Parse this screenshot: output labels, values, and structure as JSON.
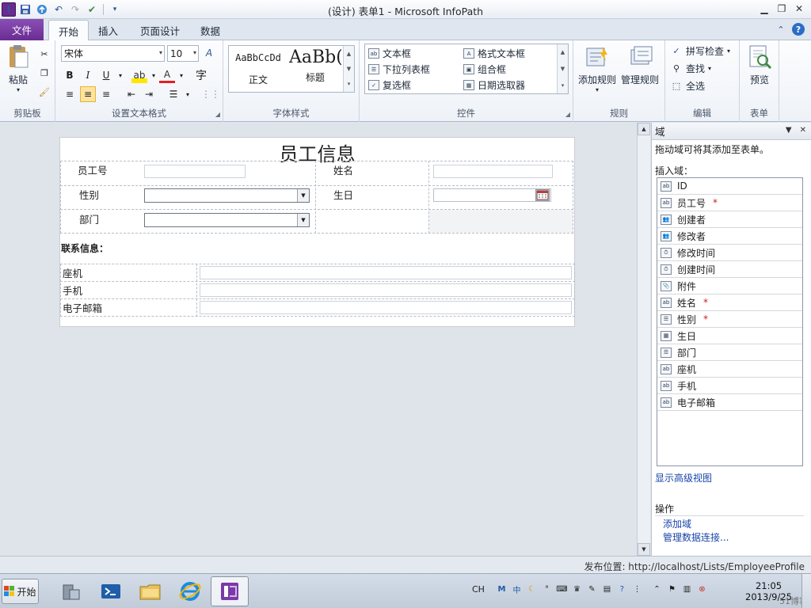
{
  "window": {
    "title": "(设计) 表单1 - Microsoft InfoPath",
    "app_icon_letter": "I"
  },
  "tabs": [
    {
      "label": "文件"
    },
    {
      "label": "开始"
    },
    {
      "label": "插入"
    },
    {
      "label": "页面设计"
    },
    {
      "label": "数据"
    }
  ],
  "ribbon": {
    "clipboard": {
      "paste_label": "粘贴",
      "group_label": "剪贴板"
    },
    "font": {
      "font_name": "宋体",
      "font_size": "10",
      "group_label": "设置文本格式",
      "char_btn": "字"
    },
    "styles": {
      "normal_preview": "AaBbCcDd",
      "normal_label": "正文",
      "heading_preview": "AaBb(",
      "heading_label": "标题",
      "group_label": "字体样式"
    },
    "controls": {
      "items": [
        "文本框",
        "下拉列表框",
        "复选框",
        "格式文本框",
        "组合框",
        "日期选取器"
      ],
      "group_label": "控件"
    },
    "rules": {
      "add_label": "添加规则",
      "manage_label": "管理规则",
      "group_label": "规则"
    },
    "edit": {
      "spell_label": "拼写检查",
      "find_label": "查找",
      "select_all_label": "全选",
      "group_label": "编辑"
    },
    "form": {
      "preview_label": "预览",
      "group_label": "表单"
    }
  },
  "form": {
    "title": "员工信息",
    "labels": {
      "emp_id": "员工号",
      "name": "姓名",
      "gender": "性别",
      "birthday": "生日",
      "dept": "部门"
    },
    "contact_heading": "联系信息：",
    "contact_rows": [
      "座机",
      "手机",
      "电子邮箱"
    ]
  },
  "pane": {
    "title": "域",
    "hint": "拖动域可将其添加至表单。",
    "insert_label": "插入域：",
    "fields": [
      {
        "name": "ID",
        "icon": "text-field-icon",
        "required": false
      },
      {
        "name": "员工号",
        "icon": "text-field-icon",
        "required": true
      },
      {
        "name": "创建者",
        "icon": "person-field-icon",
        "required": false
      },
      {
        "name": "修改者",
        "icon": "person-field-icon",
        "required": false
      },
      {
        "name": "修改时间",
        "icon": "datetime-field-icon",
        "required": false
      },
      {
        "name": "创建时间",
        "icon": "datetime-field-icon",
        "required": false
      },
      {
        "name": "附件",
        "icon": "attachment-field-icon",
        "required": false
      },
      {
        "name": "姓名",
        "icon": "text-field-icon",
        "required": true
      },
      {
        "name": "性别",
        "icon": "choice-field-icon",
        "required": true
      },
      {
        "name": "生日",
        "icon": "date-field-icon",
        "required": false
      },
      {
        "name": "部门",
        "icon": "choice-field-icon",
        "required": false
      },
      {
        "name": "座机",
        "icon": "text-field-icon",
        "required": false
      },
      {
        "name": "手机",
        "icon": "text-field-icon",
        "required": false
      },
      {
        "name": "电子邮箱",
        "icon": "text-field-icon",
        "required": false
      }
    ],
    "required_mark": "*",
    "advanced_view_link": "显示高级视图",
    "actions_heading": "操作",
    "add_field_link": "添加域",
    "manage_connections_link": "管理数据连接..."
  },
  "statusbar": {
    "publish_location": "发布位置: http://localhost/Lists/EmployeeProfile"
  },
  "taskbar": {
    "start_label": "开始",
    "lang": "CH",
    "time": "21:05",
    "date": "2013/9/25",
    "watermark": "51博客"
  },
  "colors": {
    "file_tab": "#6a2c93",
    "accent": "#2b5797",
    "required": "#d01c1c",
    "link": "#1a45a8"
  }
}
